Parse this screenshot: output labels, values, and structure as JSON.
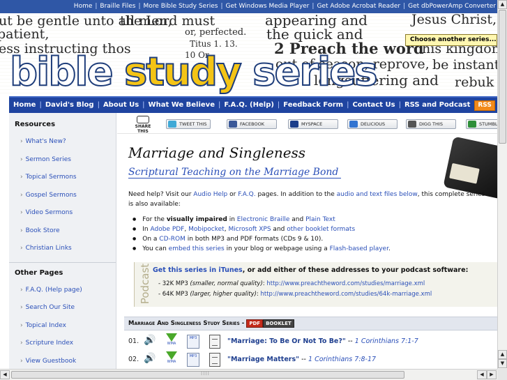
{
  "top_links": [
    "Home",
    "Braille Files",
    "More Bible Study Series",
    "Get Windows Media Player",
    "Get Adobe Acrobat Reader",
    "Get dbPowerAmp Converter"
  ],
  "banner": {
    "bg_lines": [
      "ut be gentle unto all men,",
      "patient,",
      "ess instructing thos",
      "the Lord must",
      "or, perfected.",
      "Titus 1. 13.",
      "10 Or,",
      "appearing and",
      "the quick and",
      "2 Preach the word",
      "out of season, reprove,",
      "longsuffering and",
      "Jesus Christ,",
      "his kingdom;",
      "be instant",
      "rebuk"
    ],
    "logo": {
      "word1": "bible",
      "word2": "study",
      "word3": "series"
    },
    "choose_label": "Choose another series..."
  },
  "nav": {
    "items": [
      "Home",
      "David's Blog",
      "About Us",
      "What We Believe",
      "F.A.Q. (Help)",
      "Feedback Form",
      "Contact Us",
      "RSS and Podcast"
    ],
    "rss_label": "RSS"
  },
  "sidebar": {
    "resources_heading": "Resources",
    "resources": [
      "What's New?",
      "Sermon Series",
      "Topical Sermons",
      "Gospel Sermons",
      "Video Sermons",
      "Book Store",
      "Christian Links"
    ],
    "other_heading": "Other Pages",
    "other": [
      "F.A.Q. (Help page)",
      "Search Our Site",
      "Topical Index",
      "Scripture Index",
      "View Guestbook"
    ]
  },
  "share": {
    "label": "SHARE THIS",
    "buttons": [
      {
        "label": "TWEET THIS",
        "color": "#3fa9d6"
      },
      {
        "label": "FACEBOOK",
        "color": "#3b5998"
      },
      {
        "label": "MYSPACE",
        "color": "#1c3e8a"
      },
      {
        "label": "DELICIOUS",
        "color": "#3274d1"
      },
      {
        "label": "DIGG THIS",
        "color": "#555555"
      },
      {
        "label": "STUMBLE",
        "color": "#2f8f3a"
      }
    ]
  },
  "main": {
    "title": "Marriage and Singleness",
    "subtitle": "Scriptural Teaching on the Marriage Bond",
    "intro": {
      "p1": "Need help? Visit our ",
      "audio_help": "Audio Help",
      "or": " or ",
      "faq": "F.A.Q.",
      "p2": " pages. In addition to the ",
      "files_link": "audio and text files below",
      "p3": ", this complete series is also available:"
    },
    "bullets": {
      "b1_a": "For the ",
      "b1_b": "visually impaired",
      "b1_c": " in ",
      "b1_d": "Electronic Braille",
      "b1_e": " and ",
      "b1_f": "Plain Text",
      "b2_a": "In ",
      "b2_b": "Adobe PDF",
      "b2_c": ", ",
      "b2_d": "Mobipocket",
      "b2_e": ", ",
      "b2_f": "Microsoft XPS",
      "b2_g": " and ",
      "b2_h": "other booklet formats",
      "b3_a": "On a ",
      "b3_b": "CD-ROM",
      "b3_c": " in both MP3 and PDF formats (CDs 9 & 10).",
      "b4_a": "You can ",
      "b4_b": "embed this series",
      "b4_c": " in your blog or webpage using a ",
      "b4_d": "Flash-based player",
      "b4_e": "."
    },
    "podcast": {
      "vertical_label": "Podcast",
      "itunes_link": "Get this series in iTunes",
      "itunes_rest": ", or add either of these addresses to your podcast software:",
      "row2_a": "- 32K MP3 ",
      "row2_b": "(smaller, normal quality)",
      "row2_c": ": ",
      "row2_url": "http://www.preachtheword.com/studies/marriage.xml",
      "row3_a": "- 64K MP3 ",
      "row3_b": "(larger, higher quality)",
      "row3_c": ": ",
      "row3_url": "http://www.preachtheword.com/studies/64k-marriage.xml"
    },
    "series_header": "Marriage And Singleness Study Series -",
    "pdf_badge": "PDF",
    "booklet_badge": "BOOKLET",
    "sermons": [
      {
        "num": "01.",
        "title": "\"Marriage: To Be Or Not To Be?\"",
        "sep": " -- ",
        "ref": "1 Corinthians 7:1-7"
      },
      {
        "num": "02.",
        "title": "\"Marriage Matters\"",
        "sep": " -- ",
        "ref": "1 Corinthians 7:8-17"
      }
    ],
    "wma_label": "WMA",
    "mp3_label": "MP3"
  },
  "scroll": {
    "up": "▲",
    "down": "▼",
    "left": "◀",
    "right": "▶",
    "grip": "⁞⁞⁞⁞"
  }
}
